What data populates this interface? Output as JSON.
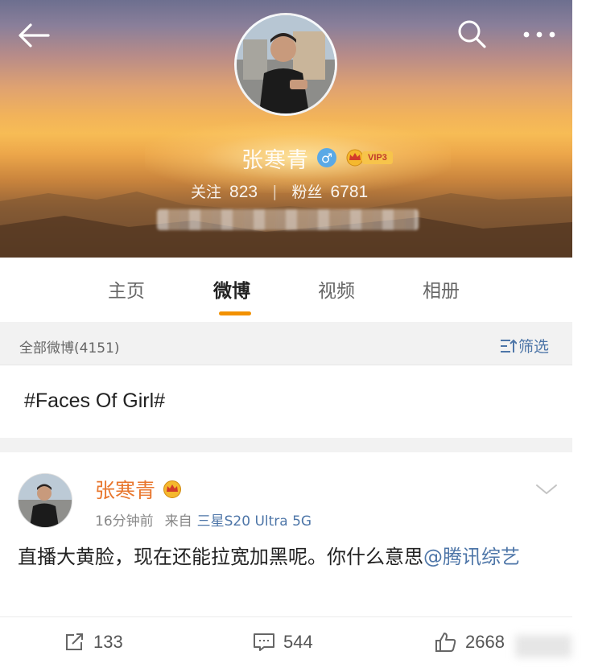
{
  "header": {
    "back_icon": "arrow-left-icon",
    "search_icon": "search-icon",
    "more_icon": "more-dots-icon",
    "profile_name": "张寒青",
    "gender_symbol": "♂",
    "vip_label": "VIP3",
    "following_label": "关注",
    "following_count": "823",
    "followers_label": "粉丝",
    "followers_count": "6781",
    "stats_separator": "|"
  },
  "tabs": [
    {
      "label": "主页",
      "active": false
    },
    {
      "label": "微博",
      "active": true
    },
    {
      "label": "视频",
      "active": false
    },
    {
      "label": "相册",
      "active": false
    }
  ],
  "filter_bar": {
    "count_label": "全部微博(4151)",
    "filter_label": "筛选",
    "filter_icon": "filter-icon"
  },
  "topic_post": {
    "text": "#Faces Of Girl#"
  },
  "post": {
    "author_name": "张寒青",
    "time": "16分钟前",
    "source_prefix": "来自",
    "device": "三星S20 Ultra 5G",
    "body_text": "直播大黄脸，现在还能拉宽加黑呢。你什么意思",
    "mention": "@腾讯综艺",
    "repost_count": "133",
    "comment_count": "544",
    "like_count": "2668"
  },
  "colors": {
    "accent_orange": "#f29100",
    "link_blue": "#4e76a8",
    "author_orange": "#e8762d"
  }
}
